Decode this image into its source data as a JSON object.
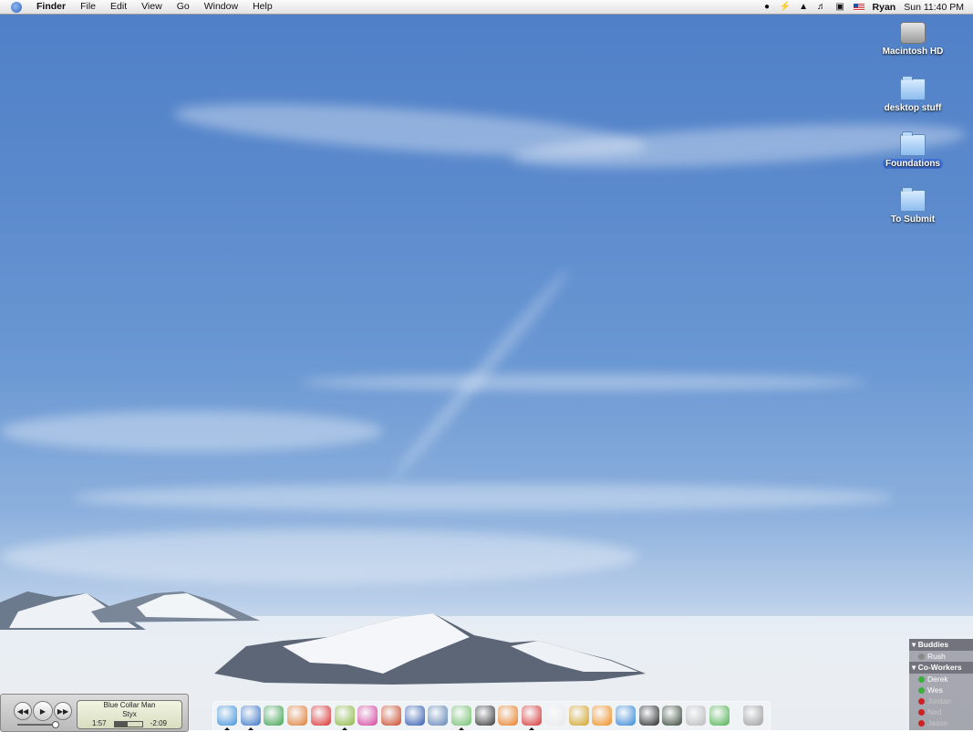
{
  "menubar": {
    "app_name": "Finder",
    "menus": [
      "File",
      "Edit",
      "View",
      "Go",
      "Window",
      "Help"
    ],
    "user": "Ryan",
    "clock": "Sun 11:40 PM"
  },
  "desktop_icons": [
    {
      "label": "Macintosh HD",
      "type": "hard-drive"
    },
    {
      "label": "desktop stuff",
      "type": "folder"
    },
    {
      "label": "Foundations",
      "type": "folder",
      "selected": true
    },
    {
      "label": "To Submit",
      "type": "folder"
    }
  ],
  "player": {
    "track": "Blue Collar Man",
    "artist": "Styx",
    "elapsed": "1:57",
    "remaining": "-2:09",
    "progress": 0.48
  },
  "dock": {
    "items": [
      {
        "name": "safari-icon",
        "color": "#3a8fd9"
      },
      {
        "name": "word-icon",
        "color": "#3572c6"
      },
      {
        "name": "excel-icon",
        "color": "#3aa04a"
      },
      {
        "name": "powerpoint-icon",
        "color": "#e0782c"
      },
      {
        "name": "acrobat-icon",
        "color": "#d92a2a"
      },
      {
        "name": "pencil-icon",
        "color": "#8ab83c"
      },
      {
        "name": "flower-icon",
        "color": "#d63c9c"
      },
      {
        "name": "fireworks-icon",
        "color": "#cc4422"
      },
      {
        "name": "globe-icon",
        "color": "#2c57b0"
      },
      {
        "name": "iphoto-icon",
        "color": "#5a7fb3"
      },
      {
        "name": "itunes-icon",
        "color": "#6fbf6a"
      },
      {
        "name": "finalcut-icon",
        "color": "#333333"
      },
      {
        "name": "firefox-icon",
        "color": "#e87b1c"
      },
      {
        "name": "ical-icon",
        "color": "#d73030"
      },
      {
        "name": "textedit-icon",
        "color": "#e8e8e8"
      },
      {
        "name": "pineapple-icon",
        "color": "#d0a020"
      },
      {
        "name": "vlc-icon",
        "color": "#f08a16"
      },
      {
        "name": "quicktime-icon",
        "color": "#2f84d6"
      },
      {
        "name": "terminal-icon",
        "color": "#222222"
      },
      {
        "name": "activity-monitor-icon",
        "color": "#334433"
      },
      {
        "name": "calculator-icon",
        "color": "#b8b8b8"
      },
      {
        "name": "adium-icon",
        "color": "#4cb04c"
      },
      {
        "name": "trash-icon",
        "color": "#9a9a9a"
      }
    ]
  },
  "buddy_list": {
    "groups": [
      {
        "name": "Buddies",
        "members": [
          {
            "name": "Rush",
            "status": "idle"
          }
        ]
      },
      {
        "name": "Co-Workers",
        "members": [
          {
            "name": "Derek",
            "status": "online"
          },
          {
            "name": "Wes",
            "status": "online"
          },
          {
            "name": "Jordan",
            "status": "away"
          },
          {
            "name": "Ned",
            "status": "away"
          },
          {
            "name": "Jason",
            "status": "away"
          }
        ]
      }
    ]
  }
}
